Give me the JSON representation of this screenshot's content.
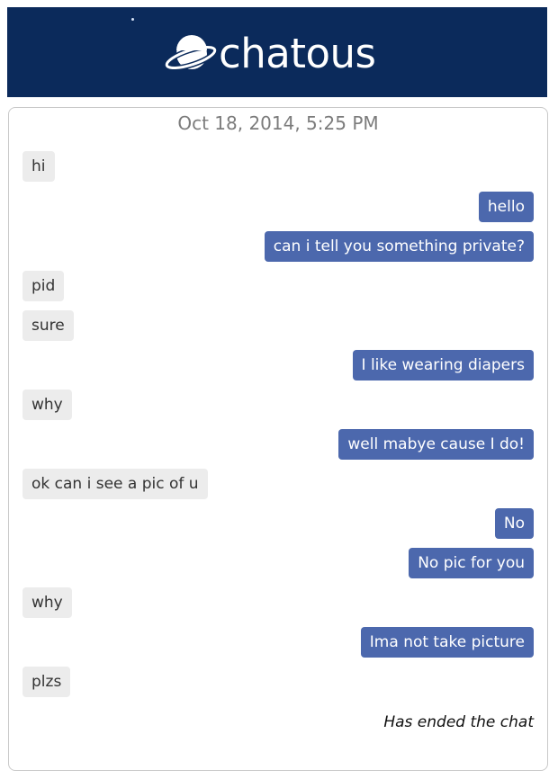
{
  "header": {
    "logo_text": "chatous",
    "brand_color": "#0b2a5b",
    "logo_icon": "planet-icon"
  },
  "chat": {
    "timestamp": "Oct 18, 2014, 5:25 PM",
    "outgoing_color": "#4c68ad",
    "incoming_color": "#ececec",
    "messages": [
      {
        "side": "them",
        "text": "hi"
      },
      {
        "side": "me",
        "text": "hello"
      },
      {
        "side": "me",
        "text": "can i tell you something private?"
      },
      {
        "side": "them",
        "text": "pid"
      },
      {
        "side": "them",
        "text": "sure"
      },
      {
        "side": "me",
        "text": "I like wearing diapers"
      },
      {
        "side": "them",
        "text": "why"
      },
      {
        "side": "me",
        "text": "well mabye cause I do!"
      },
      {
        "side": "them",
        "text": "ok can i see a pic of u"
      },
      {
        "side": "me",
        "text": "No"
      },
      {
        "side": "me",
        "text": "No pic for you"
      },
      {
        "side": "them",
        "text": "why"
      },
      {
        "side": "me",
        "text": "Ima not take picture"
      },
      {
        "side": "them",
        "text": "plzs"
      }
    ],
    "ended_text": "Has ended the chat"
  }
}
